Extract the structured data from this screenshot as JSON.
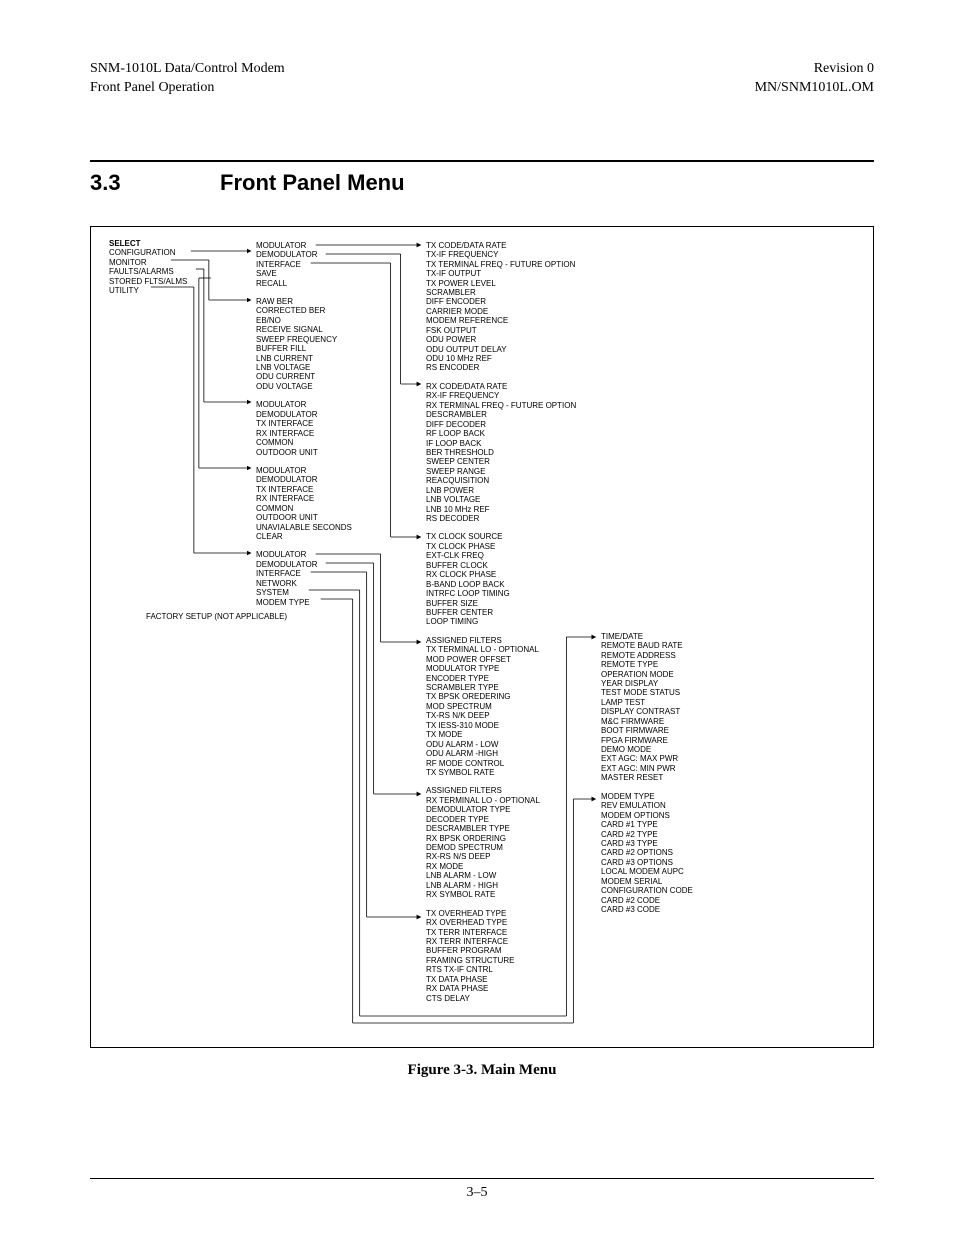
{
  "header": {
    "left1": "SNM-1010L Data/Control Modem",
    "left2": "Front Panel Operation",
    "right1": "Revision 0",
    "right2": "MN/SNM1010L.OM"
  },
  "section": {
    "number": "3.3",
    "title": "Front Panel Menu"
  },
  "caption": "Figure 3-3.  Main Menu",
  "page_number": "3–5",
  "diagram": {
    "col1": {
      "label": "SELECT",
      "items": [
        "CONFIGURATION",
        "MONITOR",
        "FAULTS/ALARMS",
        "STORED FLTS/ALMS",
        "UTILITY"
      ]
    },
    "col2_groups": [
      [
        "MODULATOR",
        "DEMODULATOR",
        "INTERFACE",
        "SAVE",
        "RECALL"
      ],
      [
        "RAW BER",
        "CORRECTED BER",
        "EB/NO",
        "RECEIVE SIGNAL",
        "SWEEP FREQUENCY",
        "BUFFER FILL",
        "LNB CURRENT",
        "LNB VOLTAGE",
        "ODU CURRENT",
        "ODU VOLTAGE"
      ],
      [
        "MODULATOR",
        "DEMODULATOR",
        "TX INTERFACE",
        "RX INTERFACE",
        "COMMON",
        "OUTDOOR UNIT"
      ],
      [
        "MODULATOR",
        "DEMODULATOR",
        "TX INTERFACE",
        "RX INTERFACE",
        "COMMON",
        "OUTDOOR UNIT",
        "UNAVIALABLE SECONDS",
        "CLEAR"
      ],
      [
        "MODULATOR",
        "DEMODULATOR",
        "INTERFACE",
        "NETWORK",
        "SYSTEM",
        "MODEM TYPE"
      ]
    ],
    "col2_tail": "FACTORY SETUP  (NOT APPLICABLE)",
    "col3_groups": [
      [
        "TX CODE/DATA RATE",
        "TX-IF FREQUENCY",
        "TX TERMINAL FREQ - FUTURE OPTION",
        "TX-IF OUTPUT",
        "TX POWER LEVEL",
        "SCRAMBLER",
        "DIFF ENCODER",
        "CARRIER MODE",
        "MODEM REFERENCE",
        "FSK OUTPUT",
        "ODU POWER",
        "ODU OUTPUT DELAY",
        "ODU 10 MHz REF",
        "RS ENCODER"
      ],
      [
        "RX CODE/DATA RATE",
        "RX-IF FREQUENCY",
        "RX TERMINAL FREQ - FUTURE OPTION",
        "DESCRAMBLER",
        "DIFF DECODER",
        "RF LOOP BACK",
        "IF LOOP BACK",
        "BER THRESHOLD",
        "SWEEP CENTER",
        "SWEEP RANGE",
        "REACQUISITION",
        "LNB POWER",
        "LNB VOLTAGE",
        "LNB 10 MHz REF",
        "RS DECODER"
      ],
      [
        "TX CLOCK SOURCE",
        "TX CLOCK PHASE",
        "EXT-CLK FREQ",
        "BUFFER CLOCK",
        "RX CLOCK PHASE",
        "B-BAND LOOP BACK",
        "INTRFC LOOP TIMING",
        "BUFFER SIZE",
        "BUFFER CENTER",
        "LOOP TIMING"
      ],
      [
        "ASSIGNED FILTERS",
        "TX TERMINAL LO - OPTIONAL",
        "MOD POWER OFFSET",
        "MODULATOR TYPE",
        "ENCODER TYPE",
        "SCRAMBLER TYPE",
        "TX BPSK OREDERING",
        "MOD SPECTRUM",
        "TX-RS N/K DEEP",
        "TX IESS-310 MODE",
        "TX MODE",
        "ODU ALARM - LOW",
        "ODU ALARM -HIGH",
        "RF MODE CONTROL",
        "TX SYMBOL RATE"
      ],
      [
        "ASSIGNED FILTERS",
        "RX TERMINAL LO - OPTIONAL",
        "DEMODULATOR TYPE",
        "DECODER TYPE",
        "DESCRAMBLER TYPE",
        "RX BPSK ORDERING",
        "DEMOD SPECTRUM",
        "RX-RS N/S DEEP",
        "RX MODE",
        "LNB ALARM - LOW",
        "LNB ALARM - HIGH",
        "RX SYMBOL RATE"
      ],
      [
        "TX OVERHEAD TYPE",
        "RX OVERHEAD TYPE",
        "TX TERR INTERFACE",
        "RX TERR INTERFACE",
        "BUFFER PROGRAM",
        "FRAMING STRUCTURE",
        "RTS TX-IF CNTRL",
        "TX DATA PHASE",
        "RX DATA PHASE",
        "CTS DELAY"
      ]
    ],
    "col4_groups": [
      [
        "TIME/DATE",
        "REMOTE BAUD RATE",
        "REMOTE ADDRESS",
        "REMOTE TYPE",
        "OPERATION MODE",
        "YEAR DISPLAY",
        "TEST MODE STATUS",
        "LAMP TEST",
        "DISPLAY CONTRAST",
        "M&C FIRMWARE",
        "BOOT FIRMWARE",
        "FPGA FIRMWARE",
        "DEMO MODE",
        "EXT AGC: MAX PWR",
        "EXT AGC: MIN PWR",
        "MASTER RESET"
      ],
      [
        "MODEM TYPE",
        "REV EMULATION",
        "MODEM OPTIONS",
        "CARD #1 TYPE",
        "CARD #2 TYPE",
        "CARD #3 TYPE",
        "CARD #2 OPTIONS",
        "CARD #3 OPTIONS",
        "LOCAL MODEM AUPC",
        "MODEM SERIAL",
        "CONFIGURATION CODE",
        "CARD #2 CODE",
        "CARD #3 CODE"
      ]
    ]
  }
}
